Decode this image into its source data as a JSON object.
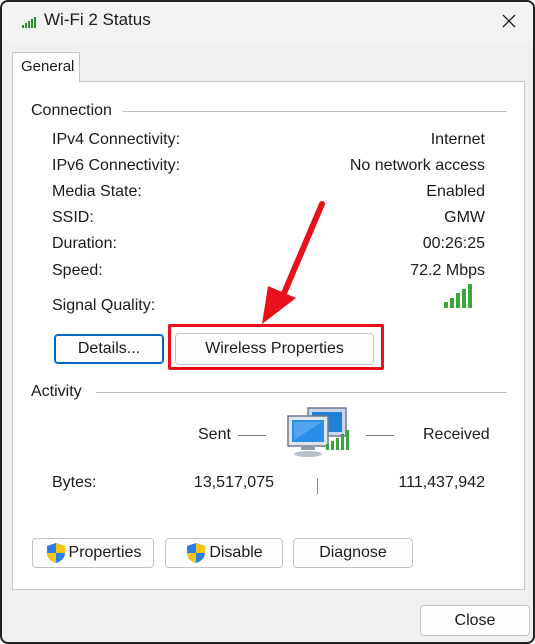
{
  "window": {
    "title": "Wi-Fi 2 Status"
  },
  "tabs": [
    {
      "label": "General"
    }
  ],
  "connection": {
    "title": "Connection",
    "rows": [
      {
        "label": "IPv4 Connectivity:",
        "value": "Internet"
      },
      {
        "label": "IPv6 Connectivity:",
        "value": "No network access"
      },
      {
        "label": "Media State:",
        "value": "Enabled"
      },
      {
        "label": "SSID:",
        "value": "GMW"
      },
      {
        "label": "Duration:",
        "value": "00:26:25"
      },
      {
        "label": "Speed:",
        "value": "72.2 Mbps"
      }
    ],
    "signal_label": "Signal Quality:",
    "signal_bars": 5,
    "details_button": "Details...",
    "wireless_button": "Wireless Properties"
  },
  "activity": {
    "title": "Activity",
    "sent_label": "Sent",
    "received_label": "Received",
    "bytes_label": "Bytes:",
    "bytes_sent": "13,517,075",
    "bytes_received": "111,437,942"
  },
  "buttons": {
    "properties": "Properties",
    "disable": "Disable",
    "diagnose": "Diagnose",
    "close": "Close"
  },
  "colors": {
    "highlight": "#e8101a",
    "signal": "#3aa63a",
    "focus": "#0067c0"
  },
  "icons": {
    "title": "wifi-signal-icon",
    "network": "network-computers-icon",
    "shield": "uac-shield-icon",
    "arrow": "red-arrow-annotation"
  }
}
